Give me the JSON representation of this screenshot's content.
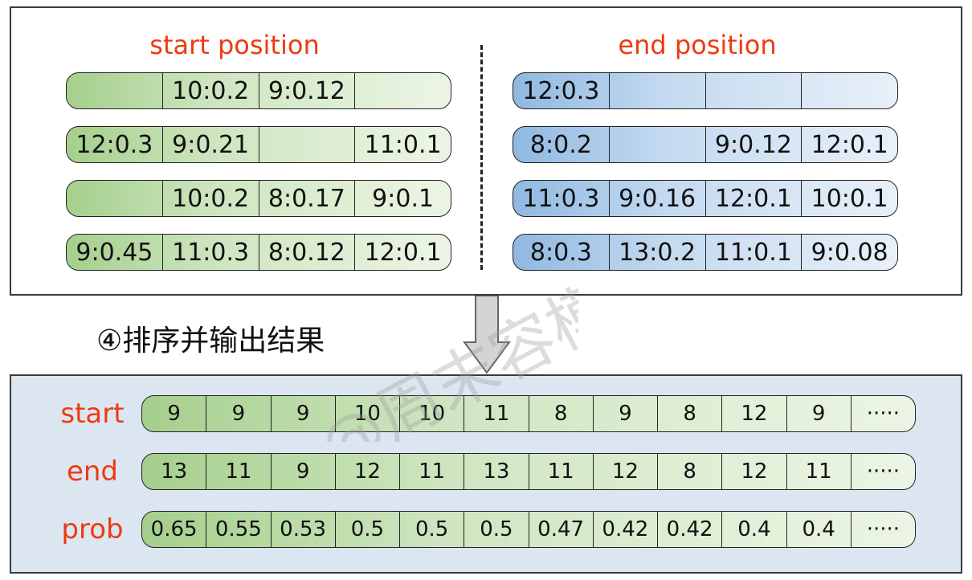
{
  "start_title": "start position",
  "end_title": "end position",
  "start_rows": [
    [
      "",
      "10:0.2",
      "9:0.12",
      ""
    ],
    [
      "12:0.3",
      "9:0.21",
      "",
      "11:0.1"
    ],
    [
      "",
      "10:0.2",
      "8:0.17",
      "9:0.1"
    ],
    [
      "9:0.45",
      "11:0.3",
      "8:0.12",
      "12:0.1"
    ]
  ],
  "end_rows": [
    [
      "12:0.3",
      "",
      "",
      ""
    ],
    [
      "8:0.2",
      "",
      "9:0.12",
      "12:0.1"
    ],
    [
      "11:0.3",
      "9:0.16",
      "12:0.1",
      "10:0.1"
    ],
    [
      "8:0.3",
      "13:0.2",
      "11:0.1",
      "9:0.08"
    ]
  ],
  "step_label": "④排序并输出结果",
  "result": {
    "start_label": "start",
    "end_label": "end",
    "prob_label": "prob",
    "start": [
      "9",
      "9",
      "9",
      "10",
      "10",
      "11",
      "8",
      "9",
      "8",
      "12",
      "9",
      "·····"
    ],
    "end": [
      "13",
      "11",
      "9",
      "12",
      "11",
      "13",
      "11",
      "12",
      "8",
      "12",
      "11",
      "·····"
    ],
    "prob": [
      "0.65",
      "0.55",
      "0.53",
      "0.5",
      "0.5",
      "0.5",
      "0.47",
      "0.42",
      "0.42",
      "0.4",
      "0.4",
      "·····"
    ]
  },
  "watermark": "@周末容模"
}
